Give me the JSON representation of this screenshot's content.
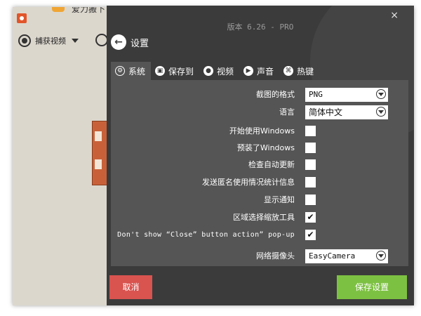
{
  "background_app": {
    "title_partial": "爱力搬下",
    "capture_label": "捕获视频",
    "logo_color": "#e2552a"
  },
  "dialog": {
    "version": "版本 6.26 - PRO",
    "close": "×",
    "back_label": "设置",
    "tabs": [
      {
        "label": "系统",
        "icon": "settings-icon",
        "active": true
      },
      {
        "label": "保存到",
        "icon": "folder-icon",
        "active": false
      },
      {
        "label": "视频",
        "icon": "record-icon",
        "active": false
      },
      {
        "label": "声音",
        "icon": "speaker-icon",
        "active": false
      },
      {
        "label": "热键",
        "icon": "hotkey-icon",
        "active": false
      }
    ],
    "settings": {
      "screenshot_format": {
        "label": "截图的格式",
        "value": "PNG"
      },
      "language": {
        "label": "语言",
        "value": "简体中文"
      },
      "start_with_windows": {
        "label": "开始使用Windows",
        "checked": false
      },
      "preinstalled_windows": {
        "label": "预装了Windows",
        "checked": false
      },
      "auto_update": {
        "label": "检查自动更新",
        "checked": false
      },
      "anonymous_stats": {
        "label": "发送匿名使用情况统计信息",
        "checked": false
      },
      "show_notifications": {
        "label": "显示通知",
        "checked": false
      },
      "zoom_tool": {
        "label": "区域选择缩放工具",
        "checked": true
      },
      "close_popup": {
        "label": "Don't show “Close” button action” pop-up",
        "checked": true
      },
      "webcam": {
        "label": "网络摄像头",
        "value": "EasyCamera"
      }
    },
    "cancel_label": "取消",
    "save_label": "保存设置",
    "colors": {
      "dialog_bg": "#3b3b3b",
      "panel_bg": "#555555",
      "cancel": "#d9534f",
      "save": "#7dc142"
    }
  }
}
